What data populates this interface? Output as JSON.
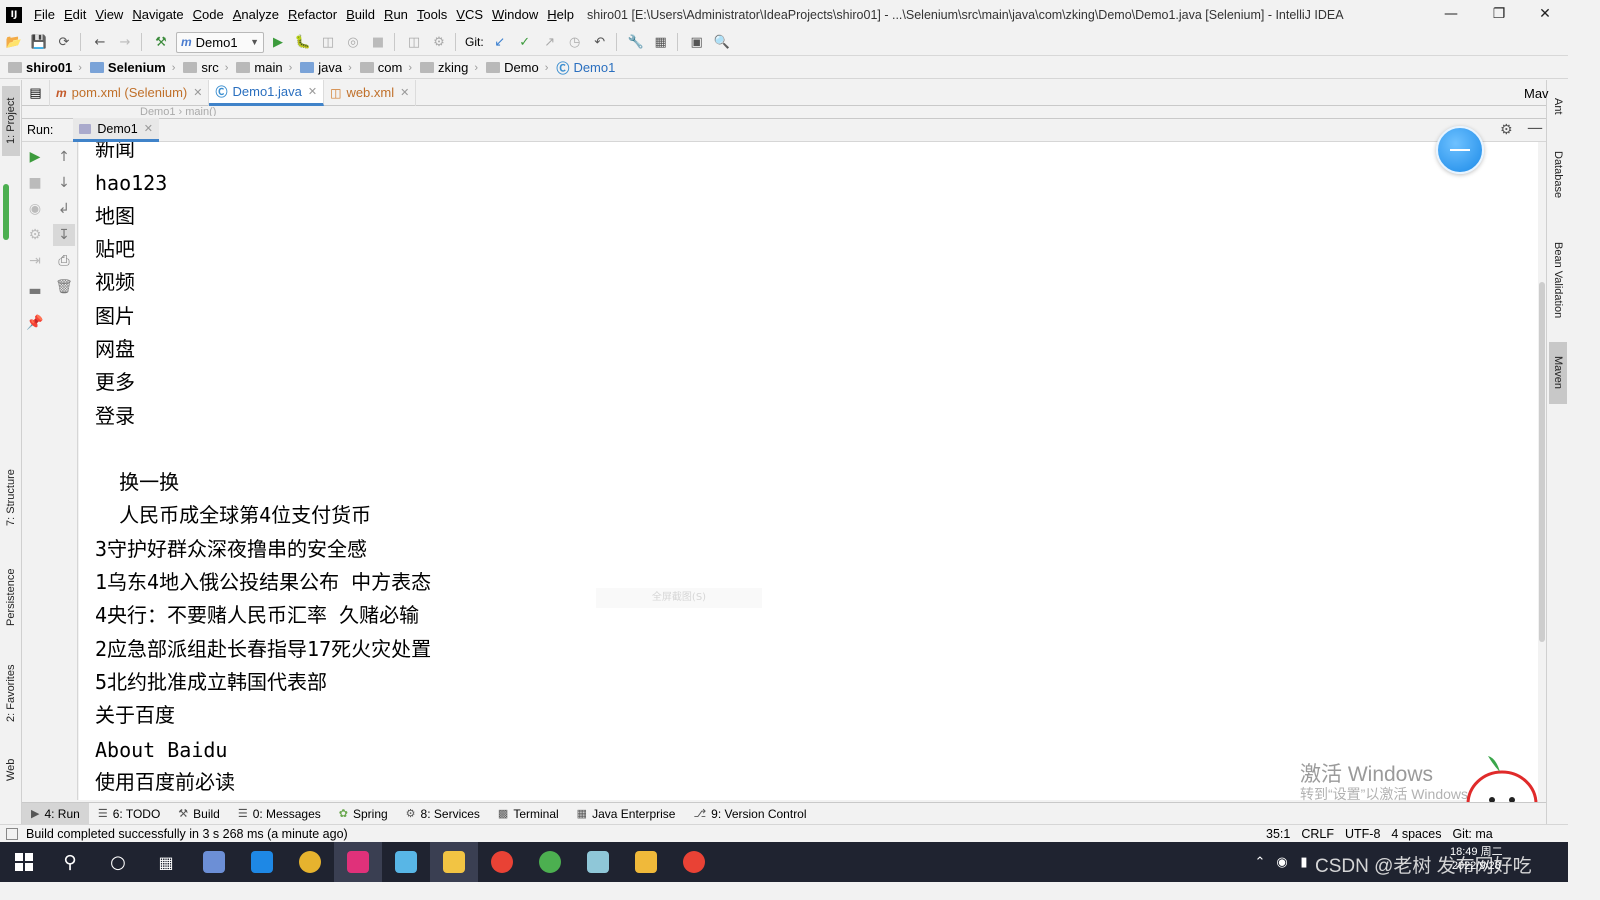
{
  "menubar": {
    "items": [
      "File",
      "Edit",
      "View",
      "Navigate",
      "Code",
      "Analyze",
      "Refactor",
      "Build",
      "Run",
      "Tools",
      "VCS",
      "Window",
      "Help"
    ],
    "window_title": "shiro01 [E:\\Users\\Administrator\\IdeaProjects\\shiro01] - ...\\Selenium\\src\\main\\java\\com\\zking\\Demo\\Demo1.java [Selenium] - IntelliJ IDEA"
  },
  "toolbar": {
    "run_config": "Demo1",
    "git_label": "Git:"
  },
  "breadcrumbs": [
    "shiro01",
    "Selenium",
    "src",
    "main",
    "java",
    "com",
    "zking",
    "Demo",
    "Demo1"
  ],
  "left_tool_tabs": [
    "1: Project",
    "7: Structure",
    "Persistence",
    "2: Favorites",
    "Web"
  ],
  "right_tool_tabs": [
    "Ant",
    "Database",
    "Bean Validation",
    "Maven"
  ],
  "editor_tabs": [
    {
      "label": "pom.xml (Selenium)",
      "icon": "m"
    },
    {
      "label": "Demo1.java",
      "icon": "C"
    },
    {
      "label": "web.xml",
      "icon": "x"
    }
  ],
  "editor_ghost": "Demo1 › main()",
  "maven_side_label": "Mav",
  "run_panel": {
    "label": "Run:",
    "tab": "Demo1"
  },
  "console_lines": [
    "新闻",
    "hao123",
    "地图",
    "贴吧",
    "视频",
    "图片",
    "网盘",
    "更多",
    "登录",
    "",
    "  换一换",
    "  人民币成全球第4位支付货币",
    "3守护好群众深夜撸串的安全感",
    "1乌东4地入俄公投结果公布 中方表态",
    "4央行：不要赌人民币汇率 久赌必输",
    "2应急部派组赴长春指导17死火灾处置",
    "5北约批准成立韩国代表部",
    "关于百度",
    "About Baidu",
    "使用百度前必读"
  ],
  "console_hint": "全屏截图(S)",
  "bottom_tabs": [
    {
      "label": "4: Run",
      "icon": "play-icon"
    },
    {
      "label": "6: TODO",
      "icon": "list-icon"
    },
    {
      "label": "Build",
      "icon": "hammer-icon"
    },
    {
      "label": "0: Messages",
      "icon": "messages-icon"
    },
    {
      "label": "Spring",
      "icon": "spring-icon"
    },
    {
      "label": "8: Services",
      "icon": "services-icon"
    },
    {
      "label": "Terminal",
      "icon": "terminal-icon"
    },
    {
      "label": "Java Enterprise",
      "icon": "java-enterprise-icon"
    },
    {
      "label": "9: Version Control",
      "icon": "version-control-icon"
    }
  ],
  "status": {
    "message": "Build completed successfully in 3 s 268 ms (a minute ago)",
    "position": "35:1",
    "line_sep": "CRLF",
    "encoding": "UTF-8",
    "indent": "4 spaces",
    "git": "Git: ma"
  },
  "watermark": {
    "title": "激活 Windows",
    "subtitle": "转到“设置”以激活 Windows。"
  },
  "taskbar": {
    "clock_time": "18:49 周二",
    "clock_date": "2022/9/28",
    "tray_text": "CSDN @老树 发布网好吃"
  },
  "colors": {
    "accent": "#4083c9",
    "taskbar": "#1f2330",
    "console_bg": "#ffffff"
  }
}
